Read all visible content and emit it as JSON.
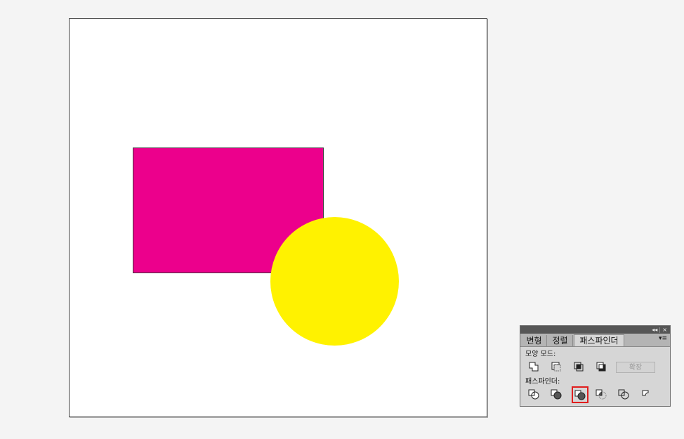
{
  "artboard": {
    "shapes": [
      {
        "kind": "rectangle",
        "color": "#ec008c"
      },
      {
        "kind": "circle",
        "color": "#fff200"
      }
    ]
  },
  "pathfinder_panel": {
    "titlebar": {
      "collapse_icon": "double-chevron-left-icon",
      "close_label": "×"
    },
    "tabs": [
      {
        "label": "변형",
        "active": false
      },
      {
        "label": "정렬",
        "active": false
      },
      {
        "label": "패스파인더",
        "active": true
      }
    ],
    "menu_icon": "panel-menu-icon",
    "shape_modes_label": "모양 모드:",
    "shape_modes": [
      "unite-icon",
      "minus-front-icon",
      "intersect-icon",
      "exclude-icon"
    ],
    "expand_label": "확장",
    "pathfinders_label": "패스파인더:",
    "pathfinders": [
      "divide-icon",
      "trim-icon",
      "merge-icon",
      "crop-icon",
      "outline-icon",
      "minus-back-icon"
    ],
    "highlighted_tool": "merge-icon",
    "highlight_color": "#e01e1e"
  }
}
